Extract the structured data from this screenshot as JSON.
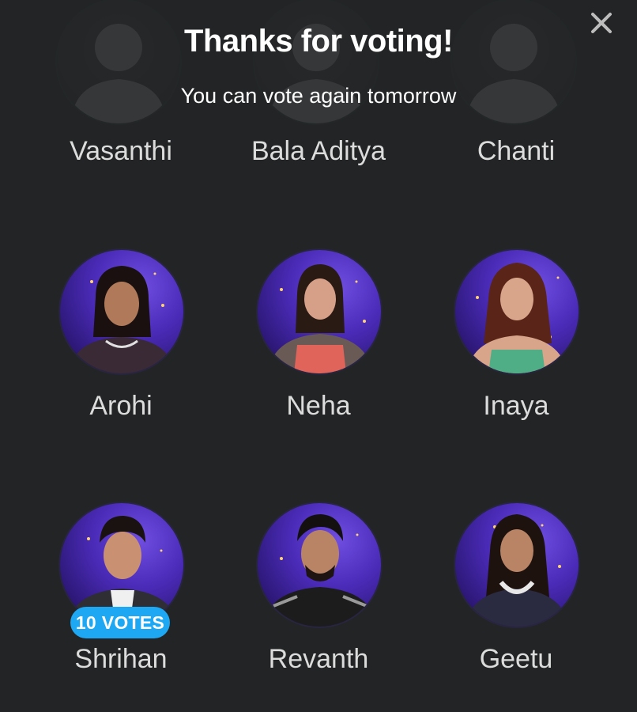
{
  "banner": {
    "title": "Thanks for voting!",
    "subtitle": "You can vote again tomorrow"
  },
  "close_icon": "close-icon",
  "contestants": [
    {
      "name": "Vasanthi",
      "state": "faded"
    },
    {
      "name": "Bala Aditya",
      "state": "faded"
    },
    {
      "name": "Chanti",
      "state": "faded"
    },
    {
      "name": "Arohi",
      "state": "normal"
    },
    {
      "name": "Neha",
      "state": "normal"
    },
    {
      "name": "Inaya",
      "state": "normal"
    },
    {
      "name": "Shrihan",
      "state": "normal",
      "votes_label": "10 VOTES"
    },
    {
      "name": "Revanth",
      "state": "normal"
    },
    {
      "name": "Geetu",
      "state": "normal"
    }
  ],
  "colors": {
    "background": "#222425",
    "badge": "#1ea7f2",
    "avatar_purple": "#4a2bb8"
  }
}
